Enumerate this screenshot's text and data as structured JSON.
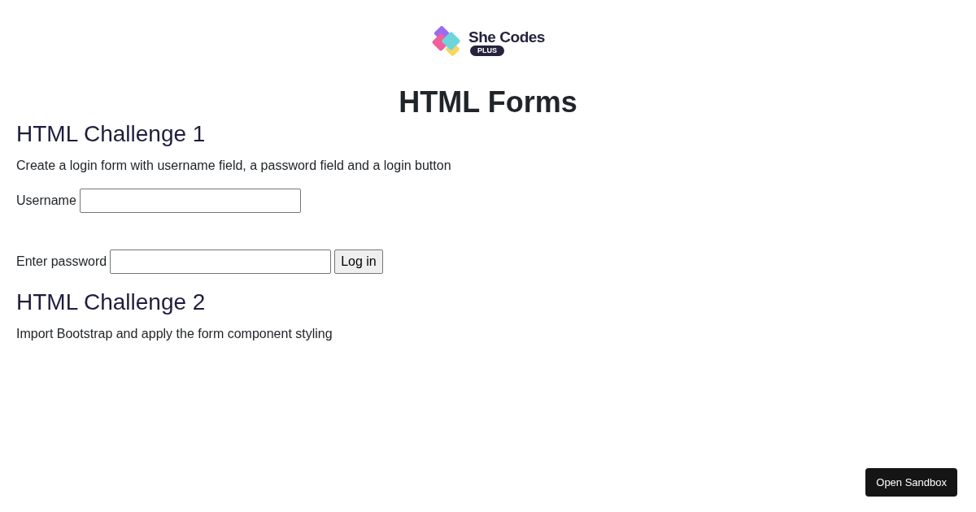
{
  "logo": {
    "name": "She Codes",
    "badge": "PLUS"
  },
  "title": "HTML Forms",
  "sections": [
    {
      "heading": "HTML Challenge 1",
      "description": "Create a login form with username field, a password field and a login button",
      "form": {
        "rows": [
          {
            "label": "Username"
          },
          {
            "label": "Enter password",
            "button": "Log in"
          }
        ]
      }
    },
    {
      "heading": "HTML Challenge 2",
      "description": "Import Bootstrap and apply the form component styling"
    }
  ],
  "sandbox_button": "Open Sandbox"
}
